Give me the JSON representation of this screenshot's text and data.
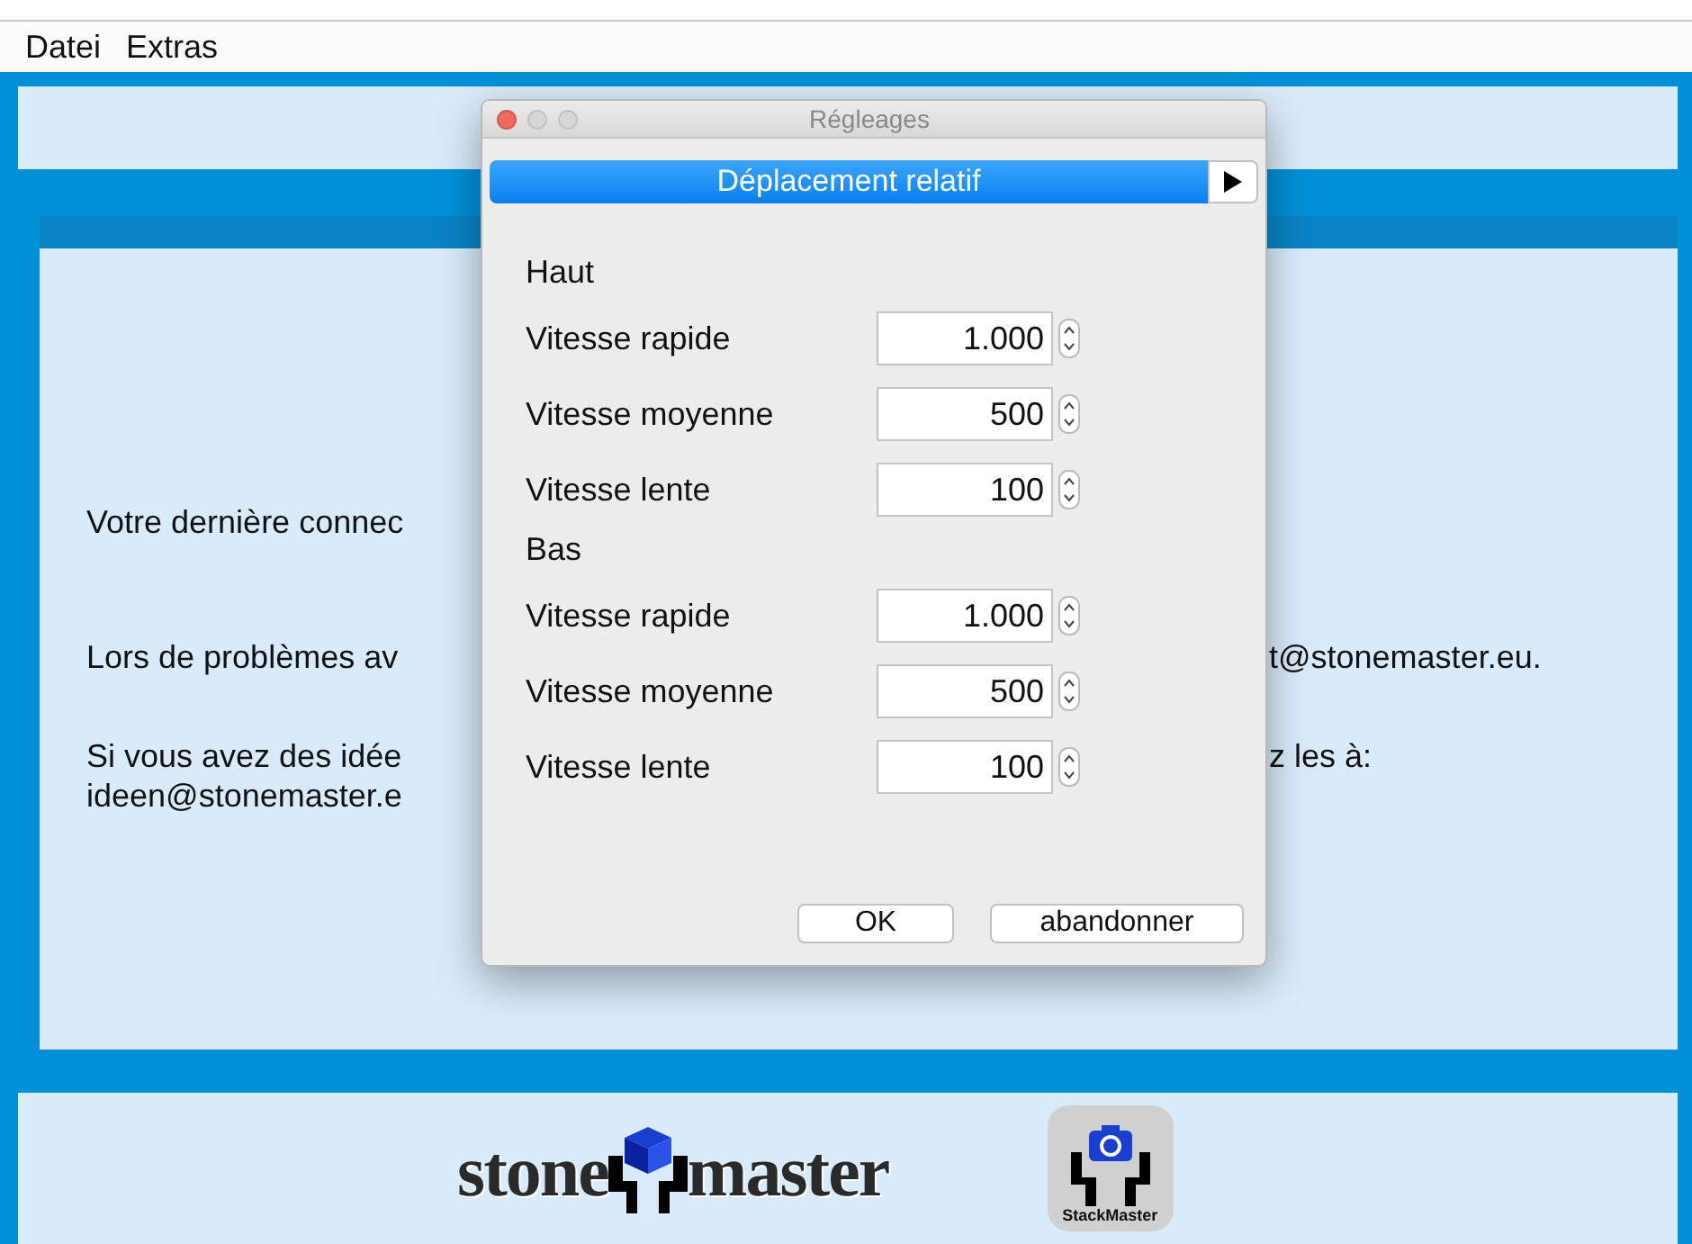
{
  "menu": [
    {
      "label": "Datei"
    },
    {
      "label": "Extras"
    }
  ],
  "background": {
    "lines": [
      {
        "left": "Votre dernière connec"
      },
      {
        "left": "Lors de problèmes av",
        "right": "t@stonemaster.eu."
      },
      {
        "left": "Si vous avez des idée",
        "right": "z les à:"
      },
      {
        "left": "ideen@stonemaster.e"
      }
    ]
  },
  "footer": {
    "logo_left": "stone",
    "logo_right": "master",
    "app_icon_label": "StackMaster"
  },
  "dialog": {
    "title": "Régleages",
    "selector": "Déplacement relatif",
    "sections": [
      {
        "title": "Haut",
        "rows": [
          {
            "label": "Vitesse rapide",
            "value": "1.000"
          },
          {
            "label": "Vitesse moyenne",
            "value": "500"
          },
          {
            "label": "Vitesse lente",
            "value": "100"
          }
        ]
      },
      {
        "title": "Bas",
        "rows": [
          {
            "label": "Vitesse rapide",
            "value": "1.000"
          },
          {
            "label": "Vitesse moyenne",
            "value": "500"
          },
          {
            "label": "Vitesse lente",
            "value": "100"
          }
        ]
      }
    ],
    "buttons": [
      "OK",
      "abandonner"
    ]
  }
}
